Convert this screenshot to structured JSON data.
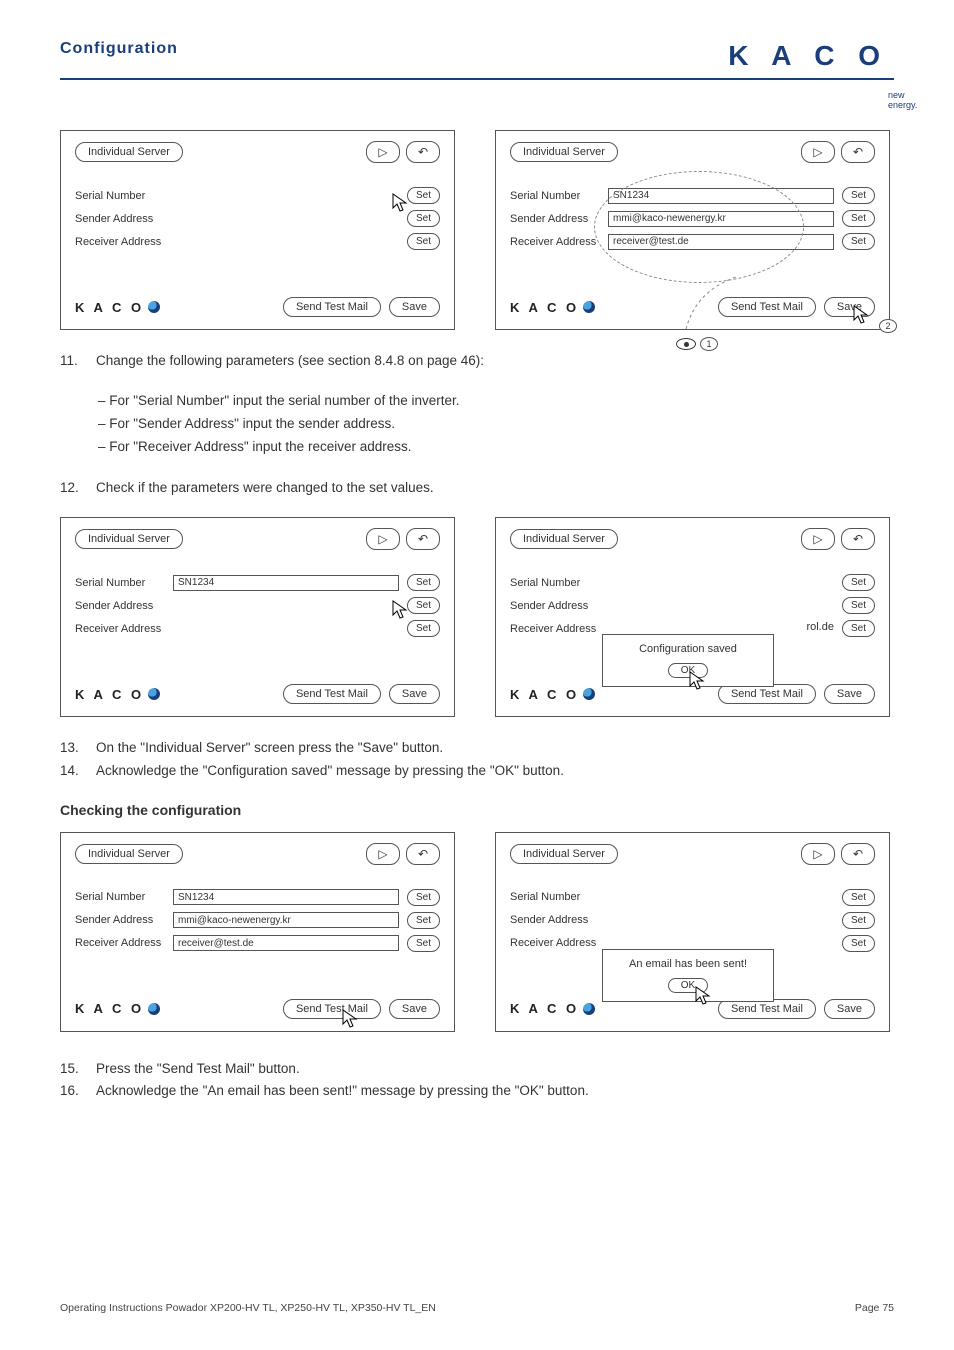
{
  "header": {
    "title": "Configuration",
    "logo": "K A C O",
    "logo_sub": "new energy."
  },
  "panels": {
    "title": "Individual Server",
    "labels": {
      "serial": "Serial Number",
      "sender": "Sender Address",
      "receiver": "Receiver Address"
    },
    "buttons": {
      "set": "Set",
      "send": "Send Test Mail",
      "save": "Save",
      "ok": "OK"
    },
    "values": {
      "serial": "SN1234",
      "sender": "mmi@kaco-newenergy.kr",
      "receiver": "receiver@test.de",
      "receiver_partial": "rol.de"
    },
    "dialogs": {
      "saved": "Configuration saved",
      "sent": "An email has been sent!"
    },
    "callouts": {
      "one": "1",
      "two": "2"
    },
    "nav": {
      "play": "▷",
      "back": "↶"
    }
  },
  "steps": {
    "s11": "Change the following parameters (see section 8.4.8 on page 46):",
    "s11a": "For \"Serial Number\" input the serial number of the inverter.",
    "s11b": "For \"Sender Address\" input the sender address.",
    "s11c": "For \"Receiver Address\" input the receiver address.",
    "s12": "Check if the parameters were changed to the set values.",
    "s13": "On the \"Individual Server\" screen press the \"Save\" button.",
    "s14": "Acknowledge the \"Configuration saved\" message by pressing the \"OK\" button.",
    "s15": "Press the \"Send Test Mail\" button.",
    "s16": "Acknowledge the \"An email has been sent!\" message by pressing the \"OK\" button."
  },
  "headings": {
    "check": "Checking the configuration"
  },
  "footer": {
    "left": "Operating Instructions Powador XP200-HV TL, XP250-HV TL, XP350-HV TL_EN",
    "right": "Page 75"
  }
}
